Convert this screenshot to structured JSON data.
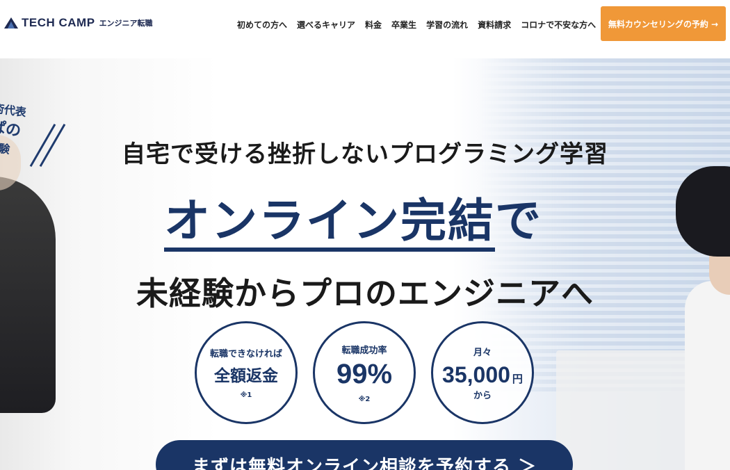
{
  "brand": {
    "name": "TECH CAMP",
    "sub": "エンジニア転職"
  },
  "nav": {
    "items": [
      {
        "label": "初めての方へ"
      },
      {
        "label": "選べるキャリア"
      },
      {
        "label": "料金"
      },
      {
        "label": "卒業生"
      },
      {
        "label": "学習の流れ"
      },
      {
        "label": "資料請求"
      },
      {
        "label": "コロナで不安な方へ"
      }
    ],
    "cta_label": "無料カウンセリングの予約 →"
  },
  "hero": {
    "side_text": [
      "術代表",
      "ぱの",
      "体験"
    ],
    "subheadline": "自宅で受ける挫折しないプログラミング学習",
    "headline_underlined": "オンライン完結",
    "headline_suffix": "で",
    "headline2": "未経験からプロのエンジニアへ",
    "badges": [
      {
        "top": "転職できなければ",
        "main": "全額返金",
        "note": "※1"
      },
      {
        "top": "転職成功率",
        "main": "99%",
        "note": "※2"
      },
      {
        "top": "月々",
        "main": "35,000",
        "unit": "円",
        "bottom": "から"
      }
    ],
    "cta_label": "まずは無料オンライン相談を予約する ＞"
  },
  "colors": {
    "navy": "#1a3566",
    "orange": "#f09838"
  }
}
